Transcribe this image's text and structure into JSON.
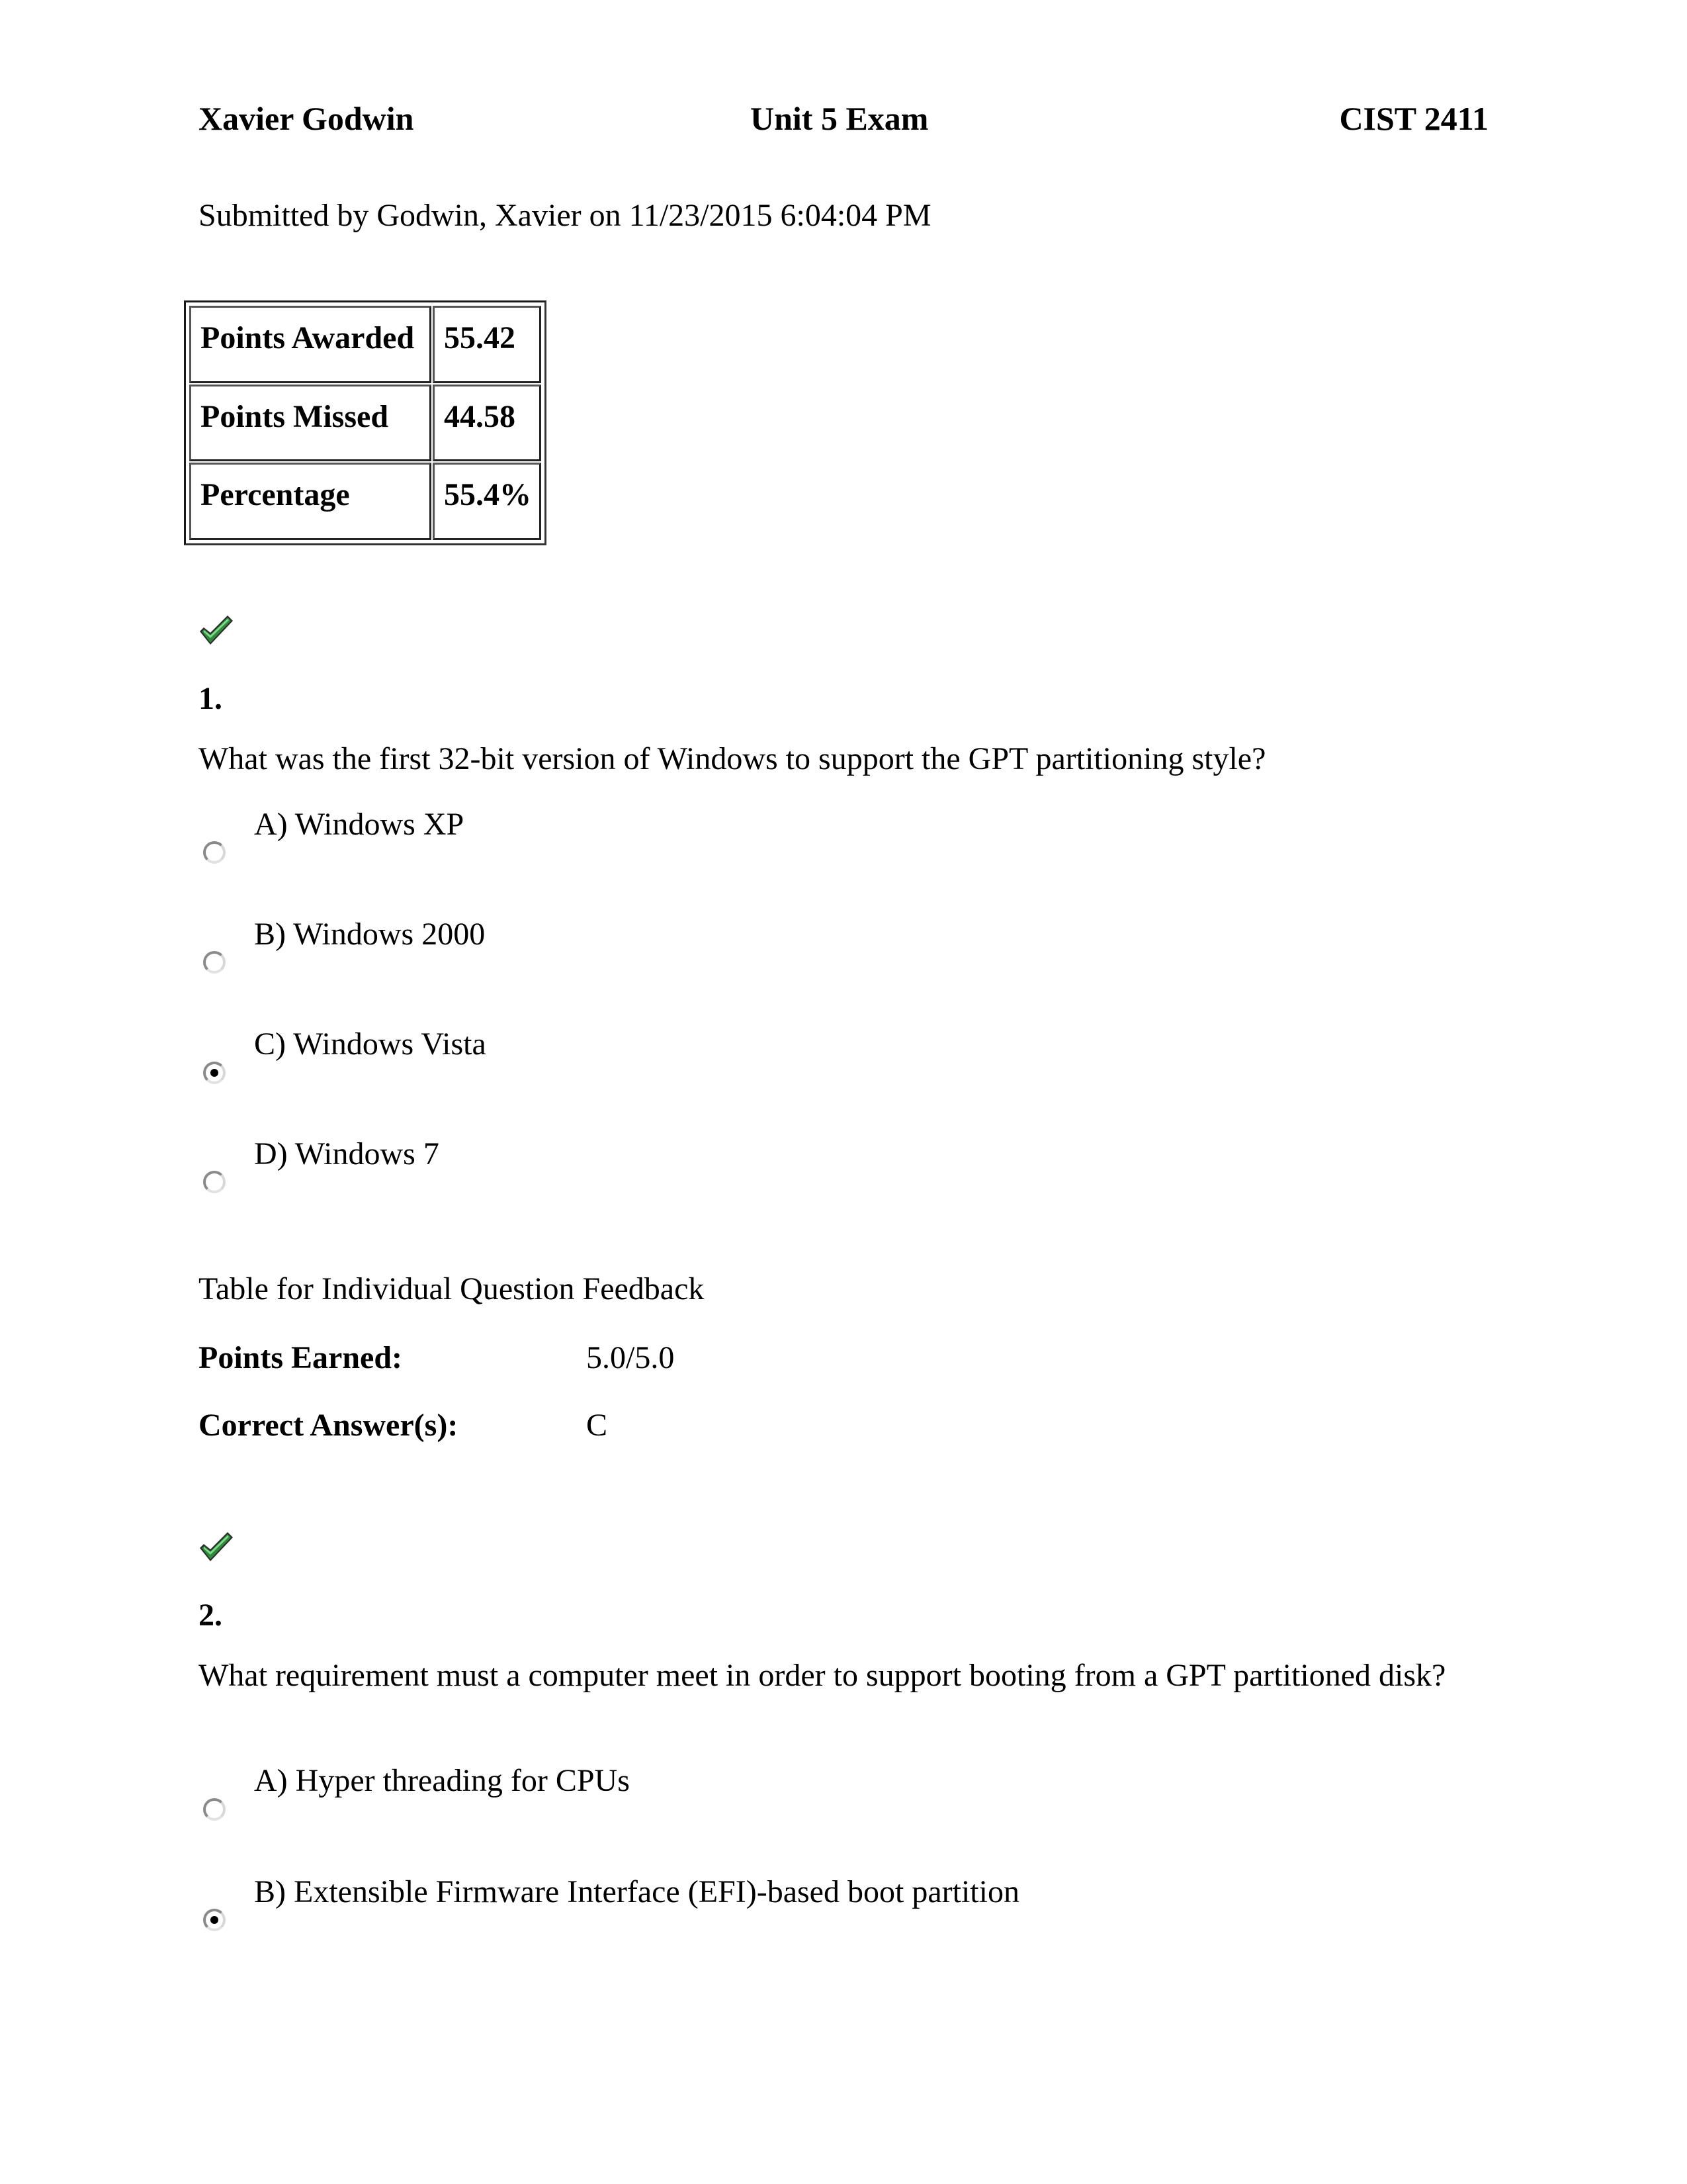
{
  "header": {
    "student_name": "Xavier Godwin",
    "exam_title": "Unit 5 Exam",
    "course": "CIST 2411"
  },
  "submission": {
    "text": "Submitted by Godwin, Xavier on 11/23/2015 6:04:04 PM"
  },
  "score_table": {
    "rows": [
      {
        "label": "Points Awarded",
        "value": "55.42"
      },
      {
        "label": "Points Missed",
        "value": "44.58"
      },
      {
        "label": "Percentage",
        "value": "55.4%"
      }
    ]
  },
  "colors": {
    "check_green": "#2e8b3a",
    "check_dark": "#0f4d18",
    "check_light": "#7fd98a"
  },
  "questions": [
    {
      "status_icon": "checkmark-icon",
      "number": "1.",
      "text": "What was the first 32-bit version of Windows to support the GPT partitioning style?",
      "options": [
        {
          "label": "A) Windows XP",
          "selected": false
        },
        {
          "label": "B) Windows 2000",
          "selected": false
        },
        {
          "label": "C) Windows Vista",
          "selected": true
        },
        {
          "label": "D) Windows 7",
          "selected": false
        }
      ],
      "feedback": {
        "title": "Table for Individual Question Feedback",
        "points_label": "Points Earned:",
        "points_value": "5.0/5.0",
        "answer_label": "Correct Answer(s):",
        "answer_value": "C"
      }
    },
    {
      "status_icon": "checkmark-icon",
      "number": "2.",
      "text": "What requirement must a computer meet in order to support booting from a GPT partitioned disk?",
      "options": [
        {
          "label": "A) Hyper threading for CPUs",
          "selected": false
        },
        {
          "label": "B) Extensible Firmware Interface (EFI)-based boot partition",
          "selected": true
        }
      ]
    }
  ]
}
